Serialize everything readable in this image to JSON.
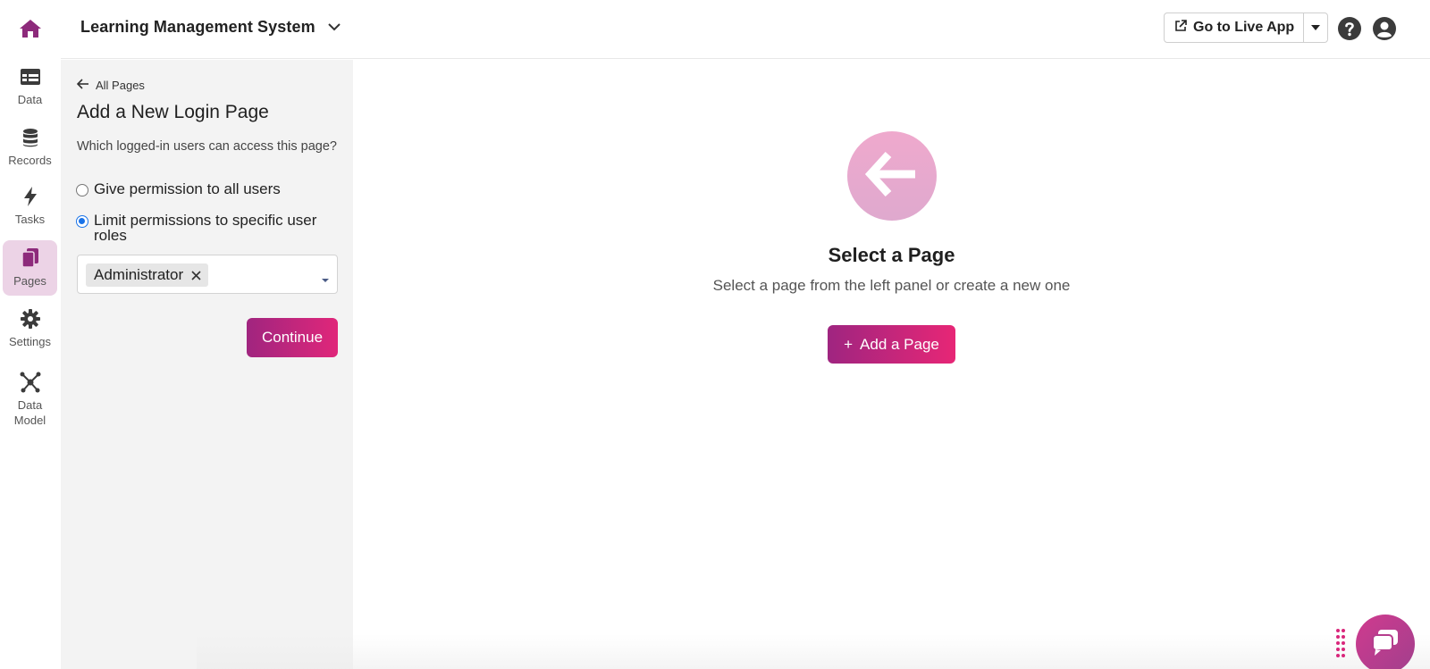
{
  "app": {
    "title": "Learning Management System"
  },
  "header": {
    "live_app_label": "Go to Live App"
  },
  "rail": {
    "items": [
      {
        "label": "Data",
        "icon": "table-icon"
      },
      {
        "label": "Records",
        "icon": "database-icon"
      },
      {
        "label": "Tasks",
        "icon": "bolt-icon"
      },
      {
        "label": "Pages",
        "icon": "pages-icon",
        "active": true
      },
      {
        "label": "Settings",
        "icon": "gear-icon"
      },
      {
        "label": "Data Model",
        "icon": "network-icon"
      }
    ]
  },
  "panel": {
    "back_label": "All Pages",
    "title": "Add a New Login Page",
    "question": "Which logged-in users can access this page?",
    "options": [
      {
        "label": "Give permission to all users",
        "checked": false
      },
      {
        "label": "Limit permissions to specific user roles",
        "checked": true
      }
    ],
    "selected_roles": [
      "Administrator"
    ],
    "continue_label": "Continue"
  },
  "empty_state": {
    "title": "Select a Page",
    "subtitle": "Select a page from the left panel or create a new one",
    "button_label": "Add a Page",
    "button_prefix": "+"
  },
  "colors": {
    "brand_start": "#a0257f",
    "brand_end": "#e0267a",
    "home_icon": "#8d2a7b",
    "active_rail_bg": "#ecd3e6",
    "panel_bg": "#f3f3f3",
    "radio_checked": "#1a73e8",
    "empty_circle": "#e8a9cf"
  }
}
